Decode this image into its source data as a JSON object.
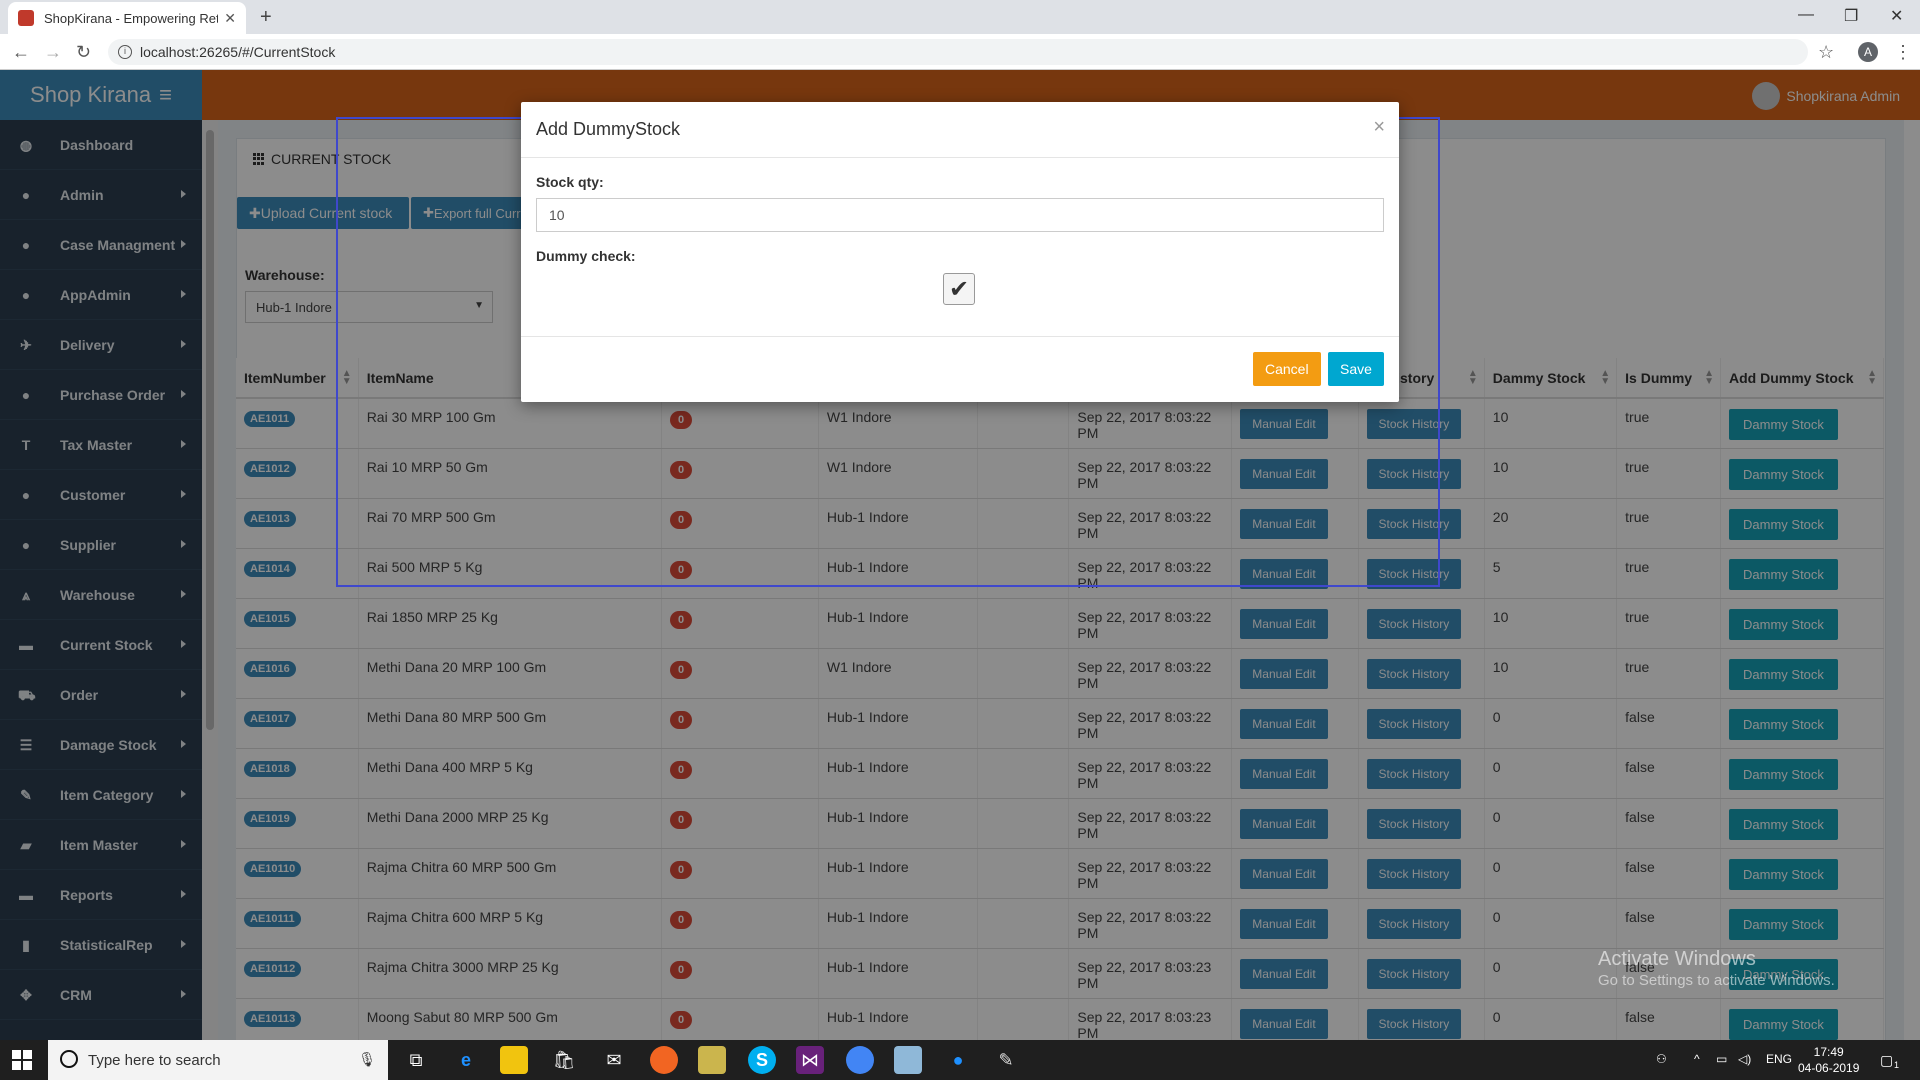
{
  "browser": {
    "tab_title": "ShopKirana - Empowering Retail",
    "url": "localhost:26265/#/CurrentStock",
    "profile_initial": "A"
  },
  "header": {
    "brand": "Shop Kirana",
    "user": "Shopkirana Admin"
  },
  "sidebar": {
    "items": [
      {
        "label": "Dashboard",
        "icon": "dashboard-icon"
      },
      {
        "label": "Admin",
        "icon": "user-icon"
      },
      {
        "label": "Case Managment",
        "icon": "user-icon"
      },
      {
        "label": "AppAdmin",
        "icon": "user-icon"
      },
      {
        "label": "Delivery",
        "icon": "plane-icon"
      },
      {
        "label": "Purchase Order",
        "icon": "user-icon"
      },
      {
        "label": "Tax Master",
        "icon": "text-icon"
      },
      {
        "label": "Customer",
        "icon": "user-icon"
      },
      {
        "label": "Supplier",
        "icon": "user-icon"
      },
      {
        "label": "Warehouse",
        "icon": "road-icon"
      },
      {
        "label": "Current Stock",
        "icon": "briefcase-icon"
      },
      {
        "label": "Order",
        "icon": "cart-icon"
      },
      {
        "label": "Damage Stock",
        "icon": "tasks-icon"
      },
      {
        "label": "Item Category",
        "icon": "pencil-icon"
      },
      {
        "label": "Item Master",
        "icon": "folder-icon"
      },
      {
        "label": "Reports",
        "icon": "briefcase-icon"
      },
      {
        "label": "StatisticalRep",
        "icon": "chart-icon"
      },
      {
        "label": "CRM",
        "icon": "move-icon"
      }
    ]
  },
  "page": {
    "title": "CURRENT STOCK",
    "upload_btn": "Upload Current stock",
    "export_btn": "Export full Curr",
    "warehouse_label": "Warehouse:",
    "warehouse_value": "Hub-1 Indore"
  },
  "table": {
    "columns": [
      "ItemNumber",
      "ItemName",
      "",
      "",
      "",
      "",
      "",
      "ck History",
      "Dammy Stock",
      "Is Dummy",
      "Add Dummy Stock"
    ],
    "manual_edit_label": "Manual Edit",
    "stock_history_label": "Stock History",
    "dammy_stock_label": "Dammy Stock",
    "zero_badge": "0",
    "rows": [
      {
        "num": "AE1011",
        "name": "Rai 30 MRP 100 Gm",
        "wh": "W1 Indore",
        "date": "Sep 22, 2017 8:03:22 PM",
        "dammy": "10",
        "is_dummy": "true"
      },
      {
        "num": "AE1012",
        "name": "Rai 10 MRP 50 Gm",
        "wh": "W1 Indore",
        "date": "Sep 22, 2017 8:03:22 PM",
        "dammy": "10",
        "is_dummy": "true"
      },
      {
        "num": "AE1013",
        "name": "Rai 70 MRP 500 Gm",
        "wh": "Hub-1 Indore",
        "date": "Sep 22, 2017 8:03:22 PM",
        "dammy": "20",
        "is_dummy": "true"
      },
      {
        "num": "AE1014",
        "name": "Rai 500 MRP 5 Kg",
        "wh": "Hub-1 Indore",
        "date": "Sep 22, 2017 8:03:22 PM",
        "dammy": "5",
        "is_dummy": "true"
      },
      {
        "num": "AE1015",
        "name": "Rai 1850 MRP 25 Kg",
        "wh": "Hub-1 Indore",
        "date": "Sep 22, 2017 8:03:22 PM",
        "dammy": "10",
        "is_dummy": "true"
      },
      {
        "num": "AE1016",
        "name": "Methi Dana 20 MRP 100 Gm",
        "wh": "W1 Indore",
        "date": "Sep 22, 2017 8:03:22 PM",
        "dammy": "10",
        "is_dummy": "true"
      },
      {
        "num": "AE1017",
        "name": "Methi Dana 80 MRP 500 Gm",
        "wh": "Hub-1 Indore",
        "date": "Sep 22, 2017 8:03:22 PM",
        "dammy": "0",
        "is_dummy": "false"
      },
      {
        "num": "AE1018",
        "name": "Methi Dana 400 MRP 5 Kg",
        "wh": "Hub-1 Indore",
        "date": "Sep 22, 2017 8:03:22 PM",
        "dammy": "0",
        "is_dummy": "false"
      },
      {
        "num": "AE1019",
        "name": "Methi Dana 2000 MRP 25 Kg",
        "wh": "Hub-1 Indore",
        "date": "Sep 22, 2017 8:03:22 PM",
        "dammy": "0",
        "is_dummy": "false"
      },
      {
        "num": "AE10110",
        "name": "Rajma Chitra 60 MRP 500 Gm",
        "wh": "Hub-1 Indore",
        "date": "Sep 22, 2017 8:03:22 PM",
        "dammy": "0",
        "is_dummy": "false"
      },
      {
        "num": "AE10111",
        "name": "Rajma Chitra 600 MRP 5 Kg",
        "wh": "Hub-1 Indore",
        "date": "Sep 22, 2017 8:03:22 PM",
        "dammy": "0",
        "is_dummy": "false"
      },
      {
        "num": "AE10112",
        "name": "Rajma Chitra 3000 MRP 25 Kg",
        "wh": "Hub-1 Indore",
        "date": "Sep 22, 2017 8:03:23 PM",
        "dammy": "0",
        "is_dummy": "false"
      },
      {
        "num": "AE10113",
        "name": "Moong Sabut 80 MRP 500 Gm",
        "wh": "Hub-1 Indore",
        "date": "Sep 22, 2017 8:03:23 PM",
        "dammy": "0",
        "is_dummy": "false"
      }
    ]
  },
  "modal": {
    "title": "Add DummyStock",
    "close": "×",
    "stock_qty_label": "Stock qty:",
    "stock_qty_value": "10",
    "dummy_check_label": "Dummy check:",
    "dummy_checked": true,
    "cancel": "Cancel",
    "save": "Save"
  },
  "watermark": {
    "line1": "Activate Windows",
    "line2": "Go to Settings to activate Windows."
  },
  "taskbar": {
    "search_placeholder": "Type here to search",
    "lang": "ENG",
    "time": "17:49",
    "date": "04-06-2019",
    "notif_count": "1"
  },
  "colors": {
    "brand_blue": "#3c8dbc",
    "header_orange": "#d9651a",
    "sidebar_dark": "#2c3e50",
    "cancel_orange": "#f39c12",
    "save_cyan": "#00a7d0",
    "danger_red": "#dd4b39",
    "teal": "#17a2b8",
    "highlight_box": "#3f48cc"
  }
}
